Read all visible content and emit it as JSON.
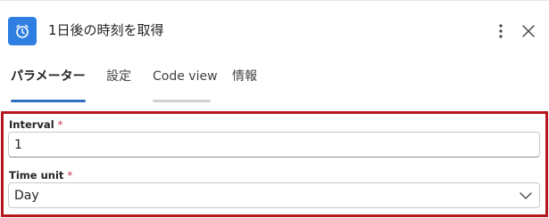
{
  "header": {
    "title": "1日後の時刻を取得",
    "app_icon": "alarm-clock-icon",
    "accent_color": "#2f7fe3"
  },
  "tabs": [
    {
      "label": "パラメーター",
      "active": true
    },
    {
      "label": "設定",
      "active": false
    },
    {
      "label": "Code view",
      "active": false
    },
    {
      "label": "情報",
      "active": false
    }
  ],
  "form": {
    "interval": {
      "label": "Interval",
      "required_mark": "*",
      "value": "1"
    },
    "time_unit": {
      "label": "Time unit",
      "required_mark": "*",
      "value": "Day"
    }
  },
  "highlight_color": "#b5171e"
}
